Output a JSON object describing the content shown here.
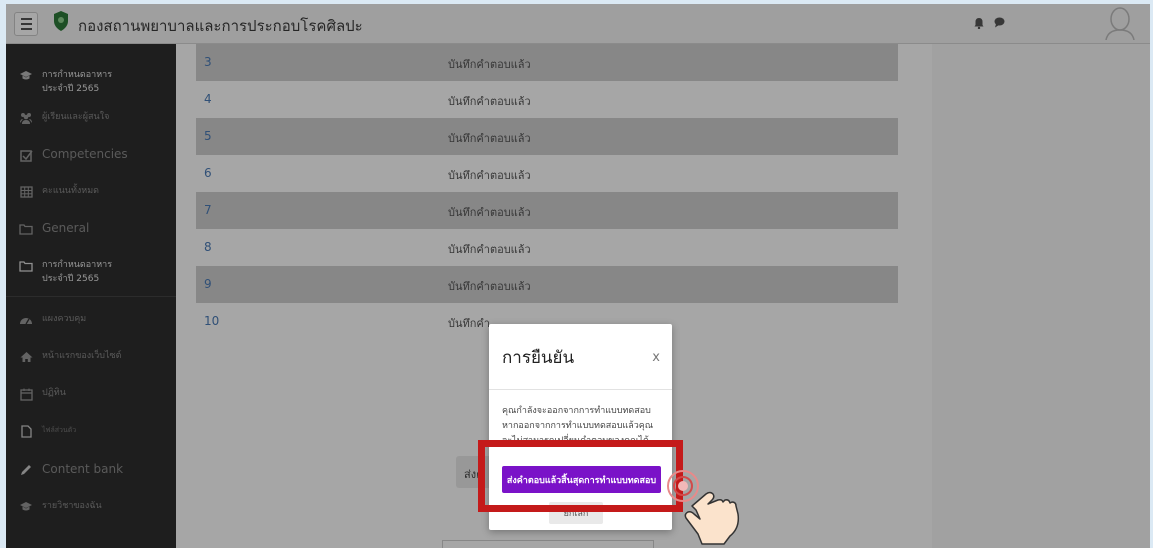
{
  "header": {
    "site_name": "กองสถานพยาบาลและการประกอบโรคศิลปะ",
    "menu_icon": "hamburger-icon",
    "notification_icon": "bell-icon",
    "message_icon": "chat-icon",
    "user_icon": "avatar-icon"
  },
  "sidebar": {
    "items": [
      {
        "label": "การกำหนดอาหาร\nประจำปี 2565",
        "icon": "graduation-cap-icon"
      },
      {
        "label": "ผู้เรียนและผู้สนใจ",
        "icon": "users-icon"
      },
      {
        "label": "Competencies",
        "icon": "checkbox-icon"
      },
      {
        "label": "คะแนนทั้งหมด",
        "icon": "table-icon"
      },
      {
        "label": "General",
        "icon": "folder-icon"
      },
      {
        "label": "การกำหนดอาหาร\nประจำปี 2565",
        "icon": "folder-icon"
      },
      {
        "label": "แผงควบคุม",
        "icon": "dashboard-icon"
      },
      {
        "label": "หน้าแรกของเว็บไซต์",
        "icon": "home-icon"
      },
      {
        "label": "ปฏิทิน",
        "icon": "calendar-icon"
      },
      {
        "label": "ไฟล์ส่วนตัว",
        "icon": "file-icon"
      },
      {
        "label": "Content bank",
        "icon": "pencil-icon"
      },
      {
        "label": "รายวิชาของฉัน",
        "icon": "graduation-cap-icon"
      }
    ]
  },
  "questions": {
    "rows": [
      {
        "number": "3",
        "status": "บันทึกคำตอบแล้ว"
      },
      {
        "number": "4",
        "status": "บันทึกคำตอบแล้ว"
      },
      {
        "number": "5",
        "status": "บันทึกคำตอบแล้ว"
      },
      {
        "number": "6",
        "status": "บันทึกคำตอบแล้ว"
      },
      {
        "number": "7",
        "status": "บันทึกคำตอบแล้ว"
      },
      {
        "number": "8",
        "status": "บันทึกคำตอบแล้ว"
      },
      {
        "number": "9",
        "status": "บันทึกคำตอบแล้ว"
      },
      {
        "number": "10",
        "status": "บันทึกคำ"
      }
    ],
    "submit_partial": "ส่งค"
  },
  "modal": {
    "title": "การยืนยัน",
    "close": "x",
    "body": "คุณกำลังจะออกจากการทำแบบทดสอบ หากออกจากการทำแบบทดสอบแล้วคุณจะไม่สามารถเปลี่ยนคำตอบของคุณได้",
    "confirm_label": "ส่งคำตอบแล้วสิ้นสุดการทำแบบทดสอบ",
    "cancel_label": "ยกเลิก"
  },
  "colors": {
    "accent_purple": "#7a12c8",
    "highlight_red": "#c41a1a",
    "sidebar_bg": "#2f2f2f",
    "link_blue": "#4a7bb7"
  }
}
